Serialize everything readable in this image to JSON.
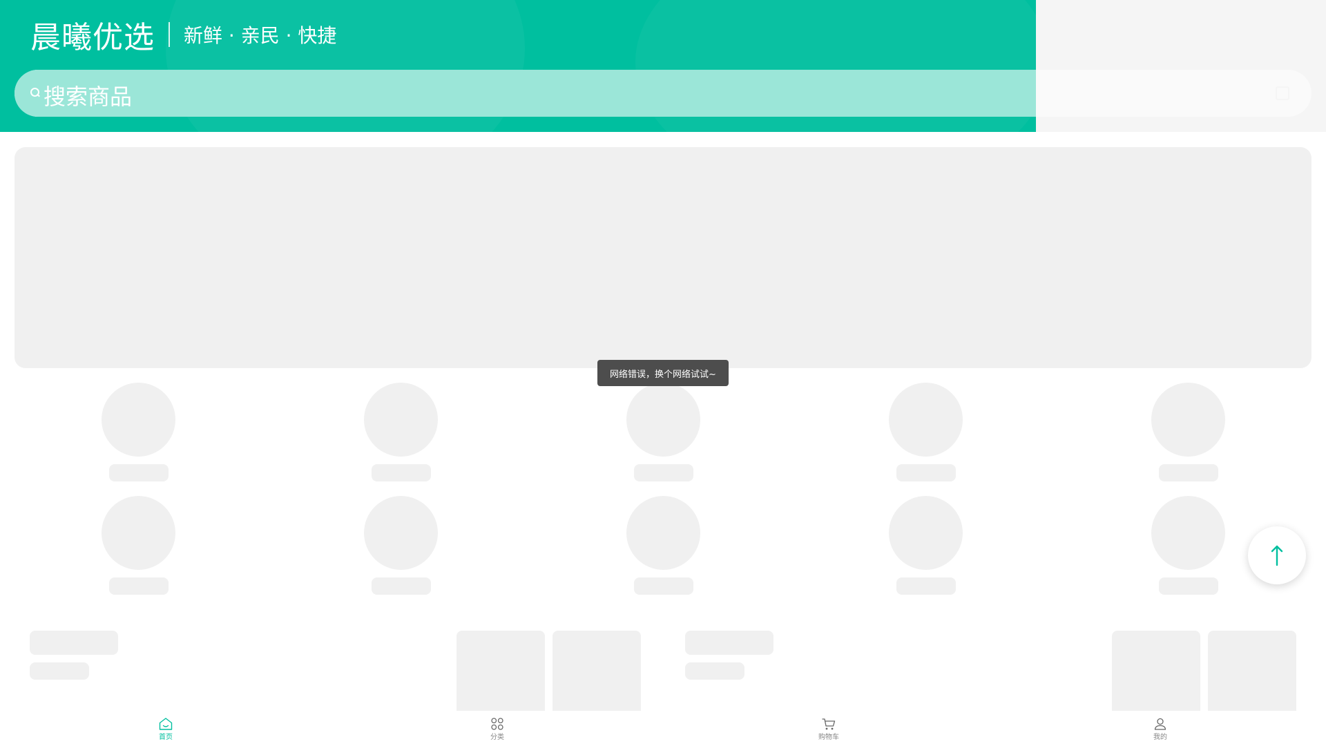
{
  "header": {
    "brand_name": "晨曦优选",
    "slogan": "新鲜 · 亲民 · 快捷"
  },
  "search": {
    "placeholder": "搜索商品",
    "icon": "search-icon"
  },
  "toast": {
    "message": "网络错误，换个网络试试~"
  },
  "back_to_top": {
    "icon": "arrow-up-icon"
  },
  "tabbar": {
    "items": [
      {
        "label": "首页",
        "icon": "home-icon",
        "active": true
      },
      {
        "label": "分类",
        "icon": "category-icon",
        "active": false
      },
      {
        "label": "购物车",
        "icon": "cart-icon",
        "active": false
      },
      {
        "label": "我的",
        "icon": "user-icon",
        "active": false
      }
    ]
  },
  "colors": {
    "brand": "#00bf9f",
    "search_tint": "#9be6d8",
    "skeleton": "#f0f0f0",
    "toast_bg": "#4d4d4d"
  }
}
